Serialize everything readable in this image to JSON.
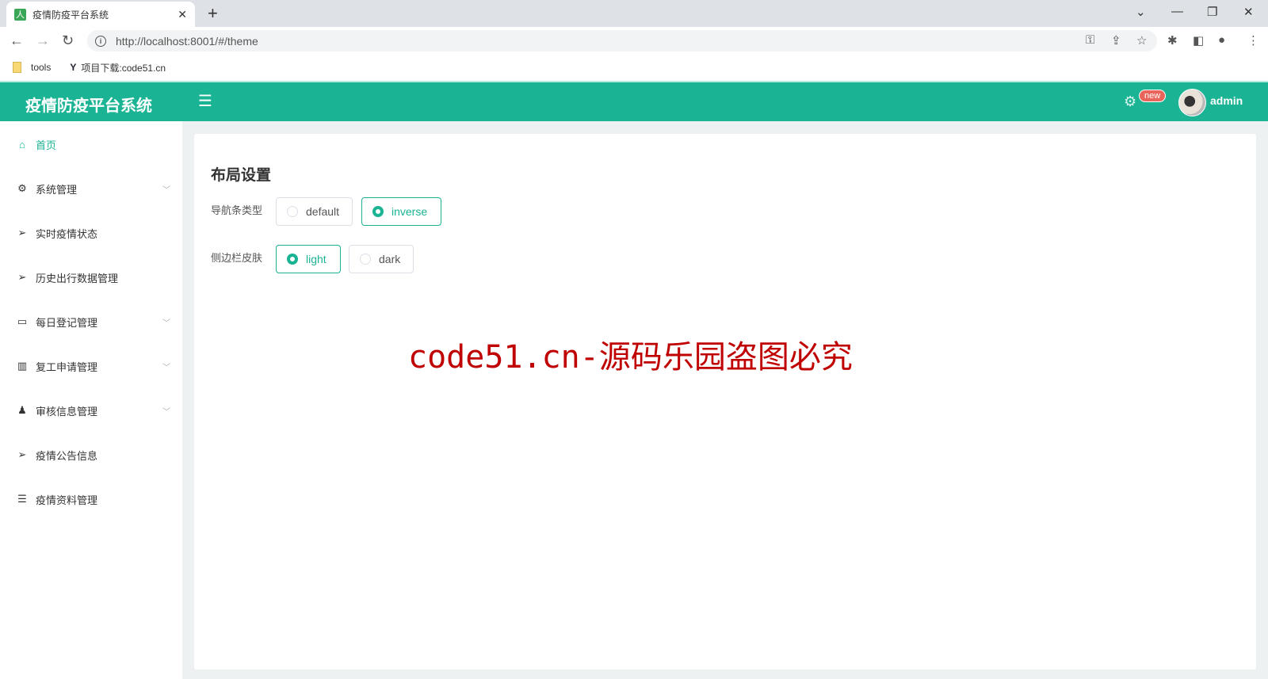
{
  "browser": {
    "tab_title": "疫情防疫平台系统",
    "favicon_text": "人",
    "url": "http://localhost:8001/#/theme",
    "bookmarks": [
      {
        "label": "tools"
      },
      {
        "label": "项目下载:code51.cn"
      }
    ]
  },
  "header": {
    "title": "疫情防疫平台系统",
    "badge": "new",
    "username": "admin",
    "color": "#1ab394"
  },
  "sidebar": {
    "items": [
      {
        "label": "首页",
        "icon": "home-icon",
        "active": true
      },
      {
        "label": "系统管理",
        "icon": "gear-icon",
        "expandable": true
      },
      {
        "label": "实时疫情状态",
        "icon": "send-icon"
      },
      {
        "label": "历史出行数据管理",
        "icon": "send-icon"
      },
      {
        "label": "每日登记管理",
        "icon": "message-icon",
        "expandable": true
      },
      {
        "label": "复工申请管理",
        "icon": "chart-bar-icon",
        "expandable": true
      },
      {
        "label": "审核信息管理",
        "icon": "user-secret-icon",
        "expandable": true
      },
      {
        "label": "疫情公告信息",
        "icon": "send-icon"
      },
      {
        "label": "疫情资料管理",
        "icon": "list-icon"
      }
    ]
  },
  "main": {
    "title": "布局设置",
    "navbar_type": {
      "label": "导航条类型",
      "options": [
        "default",
        "inverse"
      ],
      "selected": "inverse"
    },
    "sidebar_skin": {
      "label": "侧边栏皮肤",
      "options": [
        "light",
        "dark"
      ],
      "selected": "light"
    }
  },
  "watermark": "code51.cn-源码乐园盗图必究"
}
